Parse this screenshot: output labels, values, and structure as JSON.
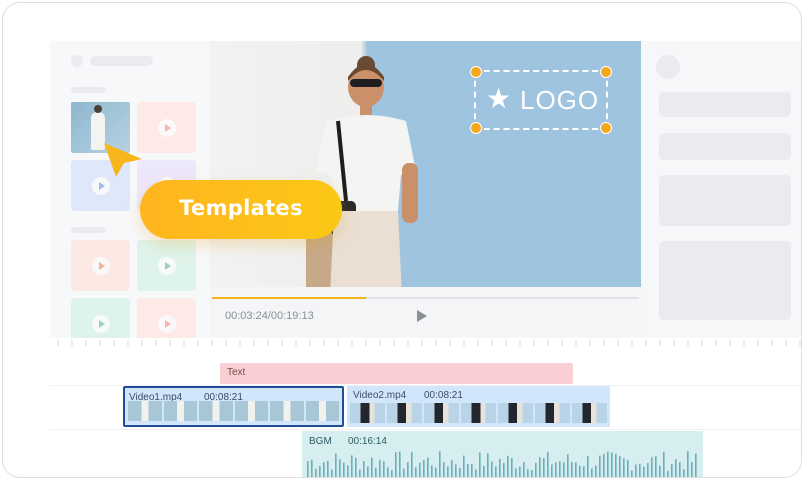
{
  "preview": {
    "logo_label": "LOGO",
    "current_time": "00:03:24",
    "total_time": "00:19:13",
    "time_display": "00:03:24/00:19:13",
    "progress": 0.36
  },
  "overlay": {
    "templates_label": "Templates"
  },
  "timeline": {
    "text_track_label": "Text",
    "video_clips": [
      {
        "name": "Video1.mp4",
        "duration": "00:08:21"
      },
      {
        "name": "Video2.mp4",
        "duration": "00:08:21"
      }
    ],
    "audio_clip": {
      "name": "BGM",
      "duration": "00:16:14"
    }
  },
  "colors": {
    "accent": "#F6B21B",
    "text_track": "#F9CFD3",
    "video_track": "#D2E6FB",
    "audio_track": "#D6EEF0",
    "selected_border": "#1F4E97"
  },
  "icons": [
    "play-icon",
    "star-icon",
    "pointer-cursor-icon"
  ]
}
